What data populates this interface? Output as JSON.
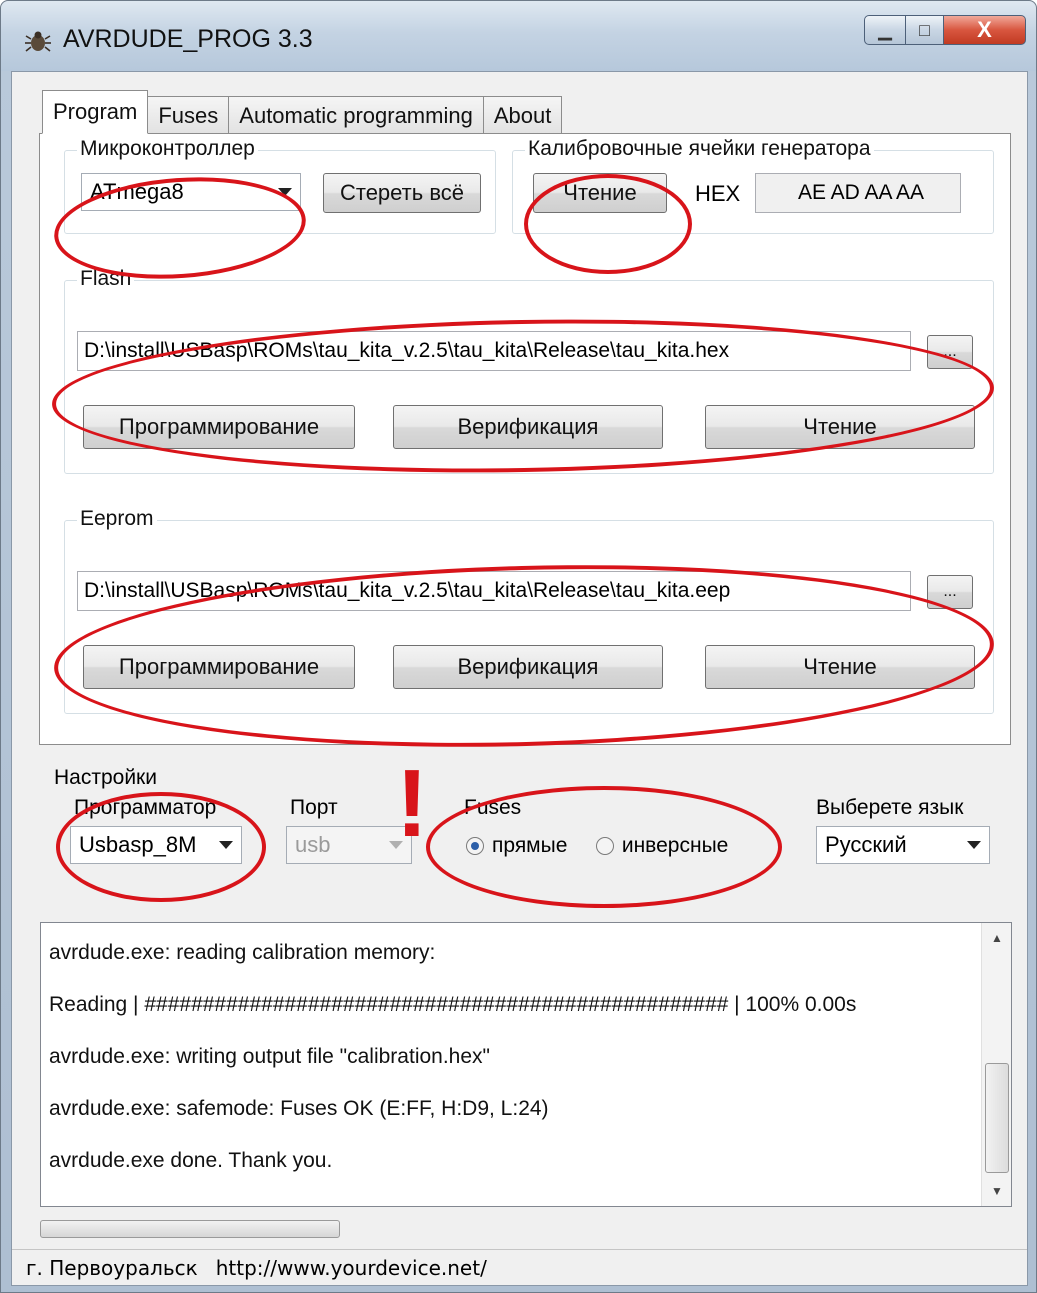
{
  "window": {
    "title": "AVRDUDE_PROG 3.3",
    "minimize": "▁",
    "maximize": "□",
    "close": "X"
  },
  "tabs": [
    {
      "label": "Program",
      "active": true
    },
    {
      "label": "Fuses"
    },
    {
      "label": "Automatic programming"
    },
    {
      "label": "About"
    }
  ],
  "mcu": {
    "group_label": "Микроконтроллер",
    "selected": "ATmega8",
    "erase_label": "Стереть всё"
  },
  "calibration": {
    "group_label": "Калибровочные ячейки генератора",
    "read_label": "Чтение",
    "hex_label": "HEX",
    "value": "AE AD AA AA"
  },
  "flash": {
    "group_label": "Flash",
    "path": "D:\\install\\USBasp\\ROMs\\tau_kita_v.2.5\\tau_kita\\Release\\tau_kita.hex",
    "browse_label": "...",
    "program_label": "Программирование",
    "verify_label": "Верификация",
    "read_label": "Чтение"
  },
  "eeprom": {
    "group_label": "Eeprom",
    "path": "D:\\install\\USBasp\\ROMs\\tau_kita_v.2.5\\tau_kita\\Release\\tau_kita.eep",
    "browse_label": "...",
    "program_label": "Программирование",
    "verify_label": "Верификация",
    "read_label": "Чтение"
  },
  "settings": {
    "group_label": "Настройки",
    "programmer_label": "Программатор",
    "programmer_value": "Usbasp_8M",
    "port_label": "Порт",
    "port_value": "usb",
    "fuses_label": "Fuses",
    "fuses_direct": "прямые",
    "fuses_inverse": "инверсные",
    "language_label": "Выберете язык",
    "language_value": "Русский",
    "exclamation": "!"
  },
  "log": {
    "lines": [
      "avrdude.exe: reading calibration memory:",
      "Reading | ################################################## | 100% 0.00s",
      "avrdude.exe: writing output file \"calibration.hex\"",
      "avrdude.exe: safemode: Fuses OK (E:FF, H:D9, L:24)",
      "avrdude.exe done.  Thank you."
    ]
  },
  "status": {
    "city": "г. Первоуральск",
    "url": "http://www.yourdevice.net/"
  },
  "colors": {
    "annotation": "#d8141a"
  }
}
